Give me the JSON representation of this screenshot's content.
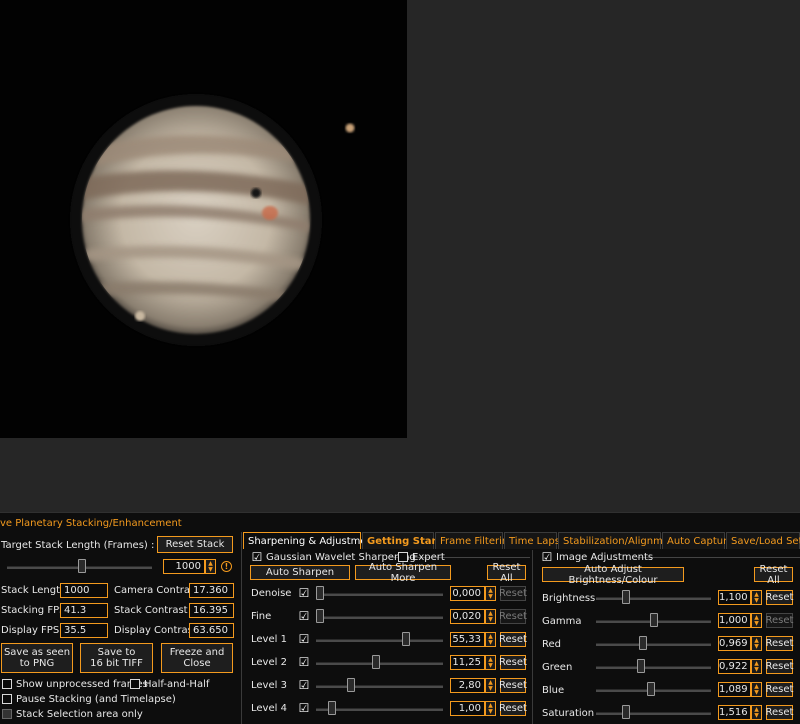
{
  "panel": {
    "title": "ve Planetary Stacking/Enhancement"
  },
  "stack": {
    "target_label": "Target Stack Length (Frames) :",
    "reset_stack": "Reset Stack",
    "target_value": "1000",
    "slider_level": 0.52,
    "stack_length_label": "Stack Length :",
    "stack_length_value": "1000",
    "stacking_fps_label": "Stacking FPS :",
    "stacking_fps_value": "41.3",
    "display_fps_label": "Display FPS :",
    "display_fps_value": "35.5",
    "camera_contrast_label": "Camera Contrast :",
    "camera_contrast_value": "17.360",
    "stack_contrast_label": "Stack Contrast :",
    "stack_contrast_value": "16.395",
    "display_contrast_label": "Display Contrast :",
    "display_contrast_value": "63.650",
    "save_png": "Save as seen\nto PNG",
    "save_tiff": "Save to\n16 bit TIFF",
    "freeze": "Freeze and\nClose",
    "show_unprocessed": "Show unprocessed frames",
    "half_and_half": "Half-and-Half",
    "pause_stacking": "Pause Stacking (and Timelapse)",
    "stack_selection": "Stack Selection area only"
  },
  "tabs": [
    {
      "label": "Sharpening & Adjustments"
    },
    {
      "label": "Getting Started"
    },
    {
      "label": "Frame Filtering"
    },
    {
      "label": "Time Lapse"
    },
    {
      "label": "Stabilization/Alignment"
    },
    {
      "label": "Auto Capture"
    },
    {
      "label": "Save/Load Settin"
    }
  ],
  "sharpening": {
    "group_label": "Gaussian Wavelet Sharpening",
    "expert_label": "Expert",
    "auto_sharpen": "Auto Sharpen",
    "auto_sharpen_more": "Auto Sharpen More",
    "reset_all": "Reset All",
    "reset_label": "Reset",
    "rows": [
      {
        "label": "Denoise",
        "value": "0,000",
        "level": 0.0
      },
      {
        "label": "Fine",
        "value": "0,020",
        "level": 0.0
      },
      {
        "label": "Level 1",
        "value": "55,33",
        "level": 0.72
      },
      {
        "label": "Level 2",
        "value": "11,25",
        "level": 0.47
      },
      {
        "label": "Level 3",
        "value": "2,80",
        "level": 0.26
      },
      {
        "label": "Level 4",
        "value": "1,00",
        "level": 0.1
      }
    ]
  },
  "image_adjust": {
    "group_label": "Image Adjustments",
    "auto_adjust": "Auto Adjust Brightness/Colour",
    "reset_all": "Reset All",
    "reset_label": "Reset",
    "rows": [
      {
        "label": "Brightness",
        "value": "1,100",
        "level": 0.24
      },
      {
        "label": "Gamma",
        "value": "1,000",
        "level": 0.5
      },
      {
        "label": "Red",
        "value": "0,969",
        "level": 0.4
      },
      {
        "label": "Green",
        "value": "0,922",
        "level": 0.38
      },
      {
        "label": "Blue",
        "value": "1,089",
        "level": 0.48
      },
      {
        "label": "Saturation",
        "value": "1,516",
        "level": 0.24
      }
    ]
  },
  "colors": {
    "accent": "#f39a1e"
  }
}
